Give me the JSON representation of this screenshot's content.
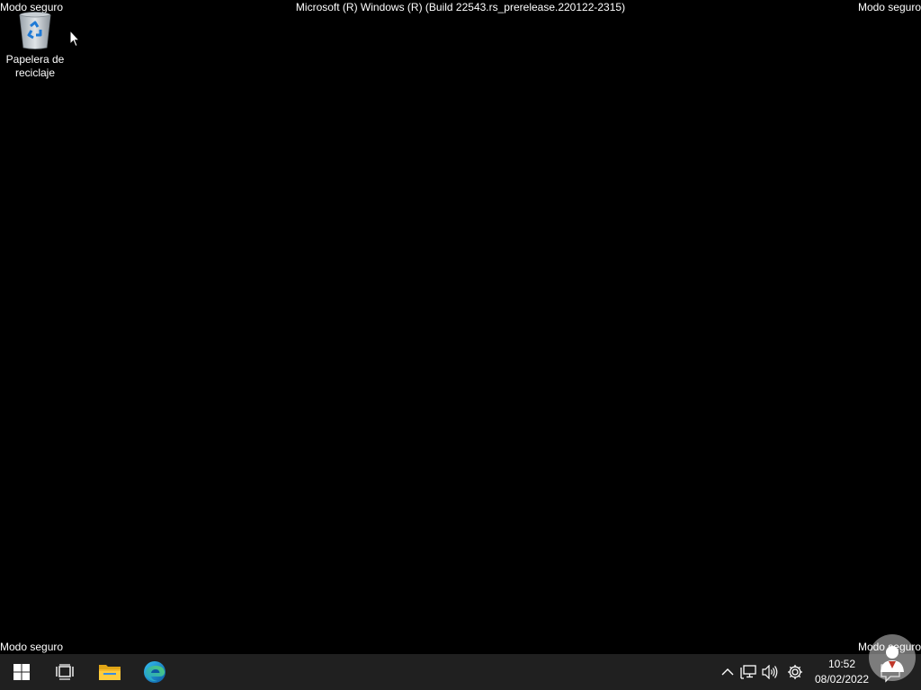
{
  "desktop": {
    "safe_mode_label_top_left": "Modo seguro",
    "safe_mode_label_top_right": "Modo seguro",
    "safe_mode_label_bottom_left": "Modo seguro",
    "safe_mode_label_bottom_right": "Modo seguro",
    "build_label": "Microsoft (R) Windows (R) (Build 22543.rs_prerelease.220122-2315)",
    "background_color": "#000000",
    "icons": [
      {
        "label_line1": "Papelera de",
        "label_line2": "reciclaje",
        "icon": "recycle-bin-icon"
      }
    ]
  },
  "taskbar": {
    "background_color": "#202020",
    "buttons": [
      {
        "name": "start",
        "icon": "windows-logo-icon"
      },
      {
        "name": "task-view",
        "icon": "task-view-icon"
      },
      {
        "name": "file-explorer",
        "icon": "folder-icon"
      },
      {
        "name": "edge",
        "icon": "edge-browser-icon"
      }
    ],
    "tray": {
      "icons": [
        "chevron-up-icon",
        "network-icon",
        "volume-icon",
        "settings-gear-icon"
      ],
      "time": "10:52",
      "date": "08/02/2022",
      "notification_icon": "notification-icon"
    }
  }
}
